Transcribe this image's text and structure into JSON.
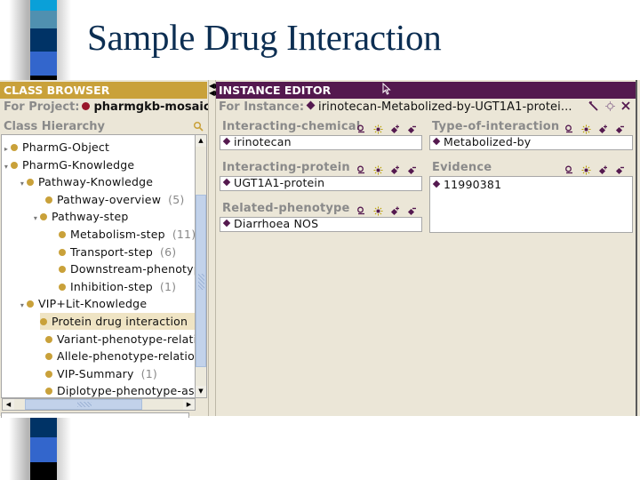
{
  "slide": {
    "title": "Sample Drug Interaction",
    "bar_colors": [
      "#0aa0d8",
      "#5090b0",
      "#003366",
      "#3366cc",
      "#000000"
    ]
  },
  "class_browser": {
    "header": "CLASS BROWSER",
    "for_project_label": "For Project:",
    "project_name": "pharmgkb-mosaic",
    "hierarchy_label": "Class Hierarchy",
    "tree": [
      {
        "label": "PharmG-Object",
        "count": "",
        "expander": "▸",
        "level": 0
      },
      {
        "label": "PharmG-Knowledge",
        "count": "",
        "expander": "▾",
        "level": 0
      },
      {
        "label": "Pathway-Knowledge",
        "count": "",
        "expander": "▾",
        "level": 1
      },
      {
        "label": "Pathway-overview",
        "count": "(5)",
        "expander": "",
        "level": 2
      },
      {
        "label": "Pathway-step",
        "count": "",
        "expander": "▾",
        "level": 2
      },
      {
        "label": "Metabolism-step",
        "count": "(11)",
        "expander": "",
        "level": 3
      },
      {
        "label": "Transport-step",
        "count": "(6)",
        "expander": "",
        "level": 3
      },
      {
        "label": "Downstream-phenotyp",
        "count": "",
        "expander": "",
        "level": 3
      },
      {
        "label": "Inhibition-step",
        "count": "(1)",
        "expander": "",
        "level": 3
      },
      {
        "label": "VIP+Lit-Knowledge",
        "count": "",
        "expander": "▾",
        "level": 1
      },
      {
        "label": "Protein drug interaction",
        "count": "",
        "expander": "",
        "level": 2,
        "selected": true
      },
      {
        "label": "Variant-phenotype-relati",
        "count": "",
        "expander": "",
        "level": 2
      },
      {
        "label": "Allele-phenotype-relatio",
        "count": "",
        "expander": "",
        "level": 2
      },
      {
        "label": "VIP-Summary",
        "count": "(1)",
        "expander": "",
        "level": 2
      },
      {
        "label": "Diplotype-phenotype-ass",
        "count": "",
        "expander": "",
        "level": 2
      }
    ]
  },
  "instance_editor": {
    "header": "INSTANCE EDITOR",
    "for_instance_label": "For Instance:",
    "instance_name": "irinotecan-Metabolized-by-UGT1A1-protei...",
    "header_tools": [
      "wand-icon",
      "hide-icon",
      "close-icon"
    ],
    "slots": {
      "interacting_chemical": {
        "label": "Interacting-chemical",
        "values": [
          "irinotecan"
        ]
      },
      "type_of_interaction": {
        "label": "Type-of-interaction",
        "values": [
          "Metabolized-by"
        ]
      },
      "interacting_protein": {
        "label": "Interacting-protein",
        "values": [
          "UGT1A1-protein"
        ]
      },
      "evidence": {
        "label": "Evidence",
        "values": [
          "11990381"
        ]
      },
      "related_phenotype": {
        "label": "Related-phenotype",
        "values": [
          "Diarrhoea NOS"
        ]
      }
    },
    "slot_actions": [
      "view-icon",
      "create-icon",
      "add-icon",
      "remove-icon"
    ]
  }
}
